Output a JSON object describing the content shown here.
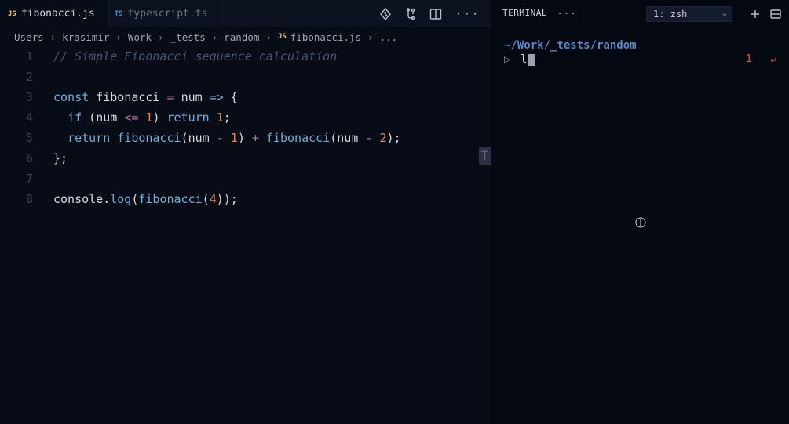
{
  "tabs": [
    {
      "label": "fibonacci.js",
      "lang": "JS",
      "active": true
    },
    {
      "label": "typescript.ts",
      "lang": "TS",
      "active": false
    }
  ],
  "breadcrumbs": {
    "segments": [
      "Users",
      "krasimir",
      "Work",
      "_tests",
      "random"
    ],
    "fileBadge": "JS",
    "file": "fibonacci.js",
    "tail": "..."
  },
  "code": {
    "lines": [
      {
        "n": "1",
        "tokens": [
          {
            "t": "// Simple Fibonacci sequence calculation",
            "c": "tok-comment"
          }
        ]
      },
      {
        "n": "2",
        "tokens": []
      },
      {
        "n": "3",
        "tokens": [
          {
            "t": "const ",
            "c": "tok-keyword"
          },
          {
            "t": "fibonacci ",
            "c": "tok-ident"
          },
          {
            "t": "= ",
            "c": "tok-op"
          },
          {
            "t": "num ",
            "c": "tok-ident"
          },
          {
            "t": "=> ",
            "c": "tok-keyword"
          },
          {
            "t": "{",
            "c": "tok-punc"
          }
        ]
      },
      {
        "n": "4",
        "tokens": [
          {
            "t": "  ",
            "c": ""
          },
          {
            "t": "if ",
            "c": "tok-keyword2"
          },
          {
            "t": "(",
            "c": "tok-punc"
          },
          {
            "t": "num ",
            "c": "tok-ident"
          },
          {
            "t": "<= ",
            "c": "tok-op"
          },
          {
            "t": "1",
            "c": "tok-num"
          },
          {
            "t": ") ",
            "c": "tok-punc"
          },
          {
            "t": "return ",
            "c": "tok-keyword2"
          },
          {
            "t": "1",
            "c": "tok-num"
          },
          {
            "t": ";",
            "c": "tok-punc"
          }
        ]
      },
      {
        "n": "5",
        "tokens": [
          {
            "t": "  ",
            "c": ""
          },
          {
            "t": "return ",
            "c": "tok-keyword2"
          },
          {
            "t": "fibonacci",
            "c": "tok-func"
          },
          {
            "t": "(",
            "c": "tok-punc"
          },
          {
            "t": "num ",
            "c": "tok-ident"
          },
          {
            "t": "- ",
            "c": "tok-op"
          },
          {
            "t": "1",
            "c": "tok-num"
          },
          {
            "t": ") ",
            "c": "tok-punc"
          },
          {
            "t": "+ ",
            "c": "tok-op"
          },
          {
            "t": "fibonacci",
            "c": "tok-func"
          },
          {
            "t": "(",
            "c": "tok-punc"
          },
          {
            "t": "num ",
            "c": "tok-ident"
          },
          {
            "t": "- ",
            "c": "tok-op"
          },
          {
            "t": "2",
            "c": "tok-num"
          },
          {
            "t": ");",
            "c": "tok-punc"
          }
        ]
      },
      {
        "n": "6",
        "tokens": [
          {
            "t": "};",
            "c": "tok-punc"
          }
        ]
      },
      {
        "n": "7",
        "tokens": []
      },
      {
        "n": "8",
        "tokens": [
          {
            "t": "console",
            "c": "tok-ident"
          },
          {
            "t": ".",
            "c": "tok-punc"
          },
          {
            "t": "log",
            "c": "tok-func"
          },
          {
            "t": "(",
            "c": "tok-paren-hl"
          },
          {
            "t": "fibonacci",
            "c": "tok-func"
          },
          {
            "t": "(",
            "c": "tok-punc"
          },
          {
            "t": "4",
            "c": "tok-num"
          },
          {
            "t": ")",
            "c": "tok-punc"
          },
          {
            "t": ")",
            "c": "tok-paren-hl"
          },
          {
            "t": ";",
            "c": "tok-punc"
          }
        ]
      }
    ]
  },
  "minimapGlyph": "T",
  "terminal": {
    "tabLabel": "TERMINAL",
    "selector": "1: zsh",
    "cwd": "~/Work/_tests/random",
    "promptGlyph": "▷",
    "command": "l",
    "status": {
      "code": "1",
      "arrow": "↵"
    }
  }
}
